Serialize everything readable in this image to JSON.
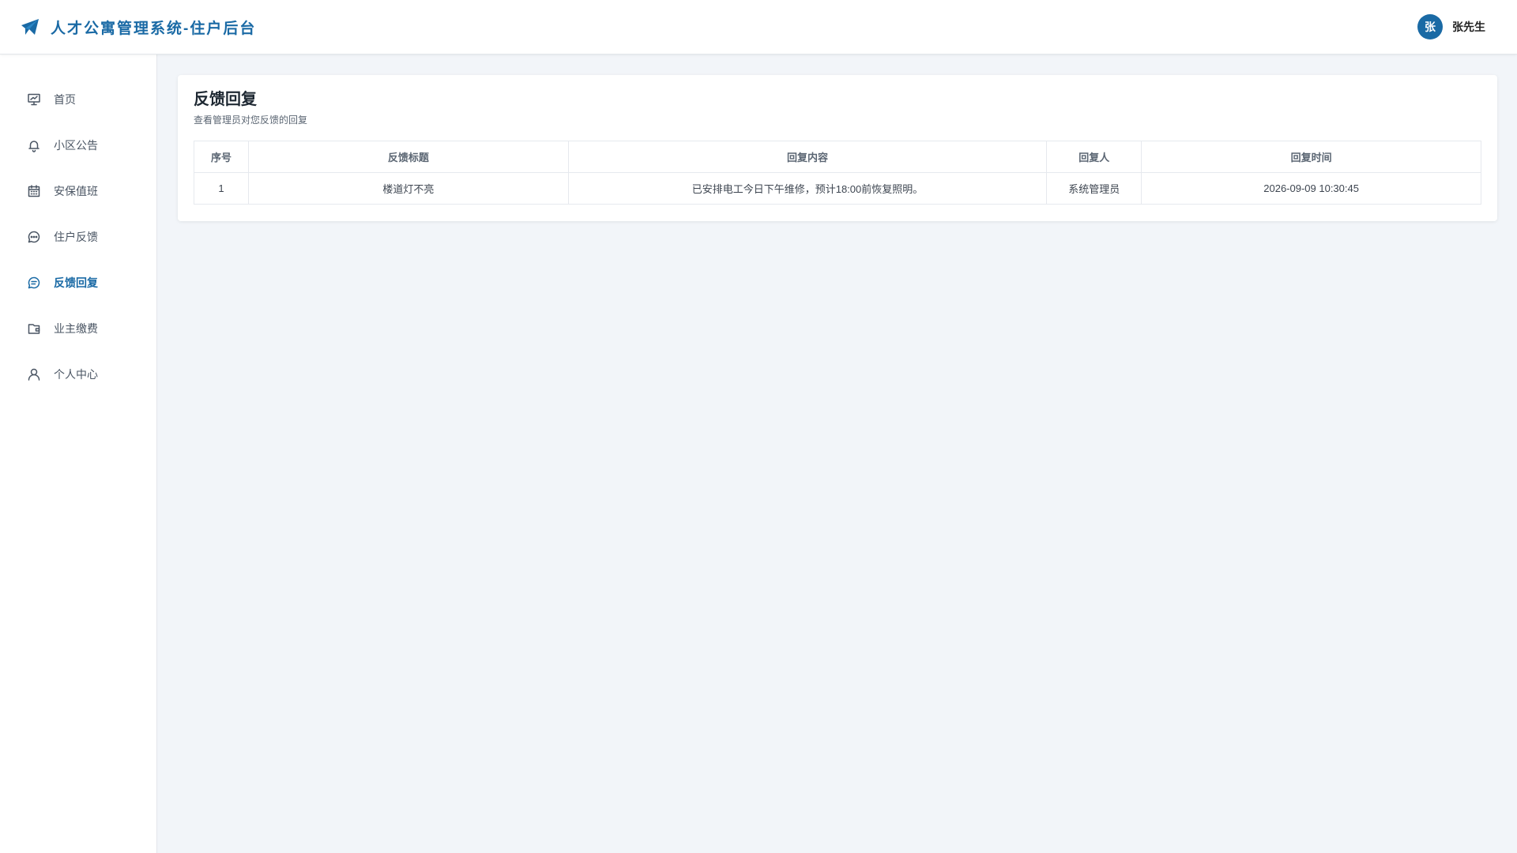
{
  "header": {
    "title": "人才公寓管理系统-住户后台",
    "user": {
      "avatar_text": "张",
      "name": "张先生"
    }
  },
  "sidebar": {
    "items": [
      {
        "label": "首页",
        "icon": "presentation-icon"
      },
      {
        "label": "小区公告",
        "icon": "bell-icon"
      },
      {
        "label": "安保值班",
        "icon": "calendar-icon"
      },
      {
        "label": "住户反馈",
        "icon": "chat-dots-icon"
      },
      {
        "label": "反馈回复",
        "icon": "chat-text-icon",
        "active": true
      },
      {
        "label": "业主缴费",
        "icon": "wallet-icon"
      },
      {
        "label": "个人中心",
        "icon": "user-icon"
      }
    ]
  },
  "main": {
    "title": "反馈回复",
    "subtitle": "查看管理员对您反馈的回复",
    "table": {
      "columns": [
        "序号",
        "反馈标题",
        "回复内容",
        "回复人",
        "回复时间"
      ],
      "rows": [
        [
          "1",
          "楼道灯不亮",
          "已安排电工今日下午维修，预计18:00前恢复照明。",
          "系统管理员",
          "2026-09-09 10:30:45"
        ]
      ]
    }
  },
  "colors": {
    "accent": "#1a6aa5",
    "background": "#f2f5f9"
  }
}
